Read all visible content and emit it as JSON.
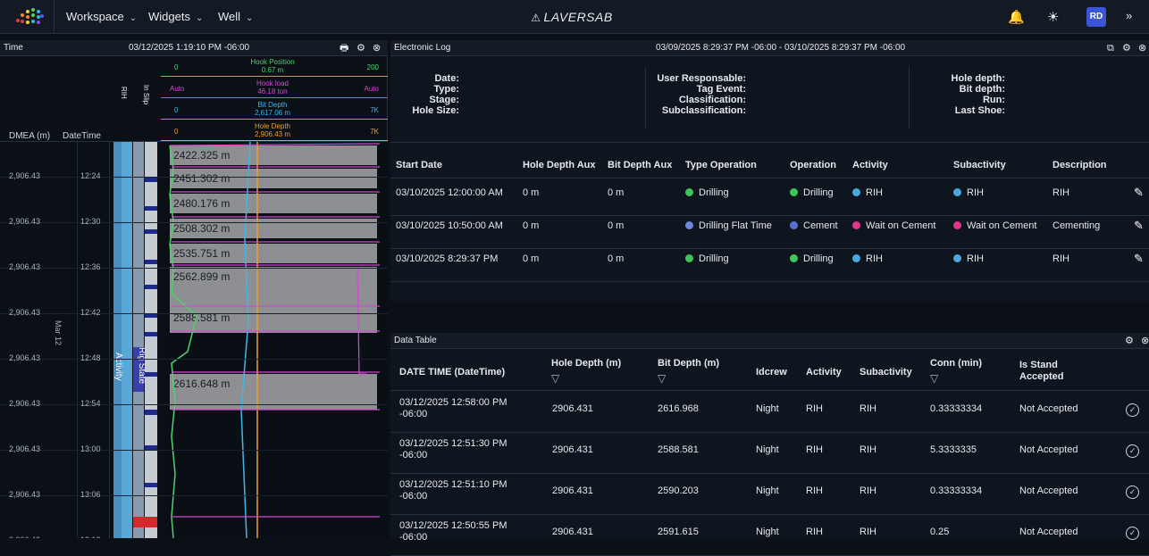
{
  "topbar": {
    "menus": [
      {
        "label": "Workspace"
      },
      {
        "label": "Widgets"
      },
      {
        "label": "Well"
      }
    ],
    "brand": "LAVERSAB",
    "avatar": "RD",
    "colors": {
      "avatar": "#3a55d6",
      "bar": "#131a24"
    }
  },
  "timelog": {
    "title": "Time",
    "timestamp": "03/12/2025 1:19:10 PM -06:00",
    "col_dmea": "DMEA (m)",
    "col_datetime": "DateTime",
    "date_label": "Mar 12",
    "track_rih": "RIH",
    "track_inslip": "In Slip",
    "track_activity": "Activity",
    "track_rigstate": "Rig State",
    "tracks": [
      {
        "name": "Hook Position",
        "value": "0.67 m",
        "min": "0",
        "max": "200",
        "color": "#4cd46a"
      },
      {
        "name": "Hook load",
        "value": "46.18 ton",
        "min": "Auto",
        "max": "Auto",
        "color": "#d14bd1"
      },
      {
        "name": "Bit Depth",
        "value": "2,617.06 m",
        "min": "0",
        "max": "7K",
        "color": "#3fb6e8"
      },
      {
        "name": "Hole Depth",
        "value": "2,906.43 m",
        "min": "0",
        "max": "7K",
        "color": "#f0a02a"
      }
    ],
    "rows": [
      {
        "dmea": "2,906.43",
        "time": "12:24"
      },
      {
        "dmea": "2,906.43",
        "time": "12:30"
      },
      {
        "dmea": "2,906.43",
        "time": "12:36"
      },
      {
        "dmea": "2,906.43",
        "time": "12:42"
      },
      {
        "dmea": "2,906.43",
        "time": "12:48"
      },
      {
        "dmea": "2,906.43",
        "time": "12:54"
      },
      {
        "dmea": "2,906.43",
        "time": "13:00"
      },
      {
        "dmea": "2,906.43",
        "time": "13:06"
      },
      {
        "dmea": "2,906.43",
        "time": "13:12"
      }
    ],
    "depth_markers": [
      "2422.325 m",
      "2451.302 m",
      "2480.176 m",
      "2508.302 m",
      "2535.751 m",
      "2562.899 m",
      "2588.581 m",
      "2616.648 m"
    ]
  },
  "elog": {
    "title": "Electronic Log",
    "range": "03/09/2025 8:29:37 PM -06:00 - 03/10/2025 8:29:37 PM -06:00",
    "fields_left": [
      "Date:",
      "Type:",
      "Stage:",
      "Hole Size:"
    ],
    "fields_mid": [
      "User Responsable:",
      "Tag Event:",
      "Classification:",
      "Subclassification:"
    ],
    "fields_right": [
      "Hole depth:",
      "Bit depth:",
      "Run:",
      "Last Shoe:"
    ],
    "headers": [
      "Start Date",
      "Hole Depth Aux",
      "Bit Depth Aux",
      "Type Operation",
      "Operation",
      "Activity",
      "Subactivity",
      "Description"
    ],
    "rows": [
      {
        "start": "03/10/2025 12:00:00 AM",
        "hole": "0 m",
        "bit": "0 m",
        "type": "Drilling",
        "type_color": "#3ec45a",
        "op": "Drilling",
        "op_color": "#3ec45a",
        "act": "RIH",
        "act_color": "#4aa8e0",
        "sub": "RIH",
        "sub_color": "#4aa8e0",
        "desc": "RIH"
      },
      {
        "start": "03/10/2025 10:50:00 AM",
        "hole": "0 m",
        "bit": "0 m",
        "type": "Drilling Flat Time",
        "type_color": "#6d86e0",
        "op": "Cement",
        "op_color": "#5a6fd0",
        "act": "Wait on Cement",
        "act_color": "#e0368c",
        "sub": "Wait on Cement",
        "sub_color": "#e0368c",
        "desc": "Cementing"
      },
      {
        "start": "03/10/2025 8:29:37 PM",
        "hole": "0 m",
        "bit": "0 m",
        "type": "Drilling",
        "type_color": "#3ec45a",
        "op": "Drilling",
        "op_color": "#3ec45a",
        "act": "RIH",
        "act_color": "#4aa8e0",
        "sub": "RIH",
        "sub_color": "#4aa8e0",
        "desc": "RIH"
      }
    ]
  },
  "datatable": {
    "title": "Data Table",
    "headers": [
      "DATE TIME (DateTime)",
      "Hole Depth (m)",
      "Bit Depth (m)",
      "Idcrew",
      "Activity",
      "Subactivity",
      "Conn (min)",
      "Is Stand Accepted"
    ],
    "rows": [
      {
        "dt": "03/12/2025 12:58:00 PM -06:00",
        "hole": "2906.431",
        "bit": "2616.968",
        "crew": "Night",
        "act": "RIH",
        "sub": "RIH",
        "conn": "0.33333334",
        "acc": "Not Accepted"
      },
      {
        "dt": "03/12/2025 12:51:30 PM -06:00",
        "hole": "2906.431",
        "bit": "2588.581",
        "crew": "Night",
        "act": "RIH",
        "sub": "RIH",
        "conn": "5.3333335",
        "acc": "Not Accepted"
      },
      {
        "dt": "03/12/2025 12:51:10 PM -06:00",
        "hole": "2906.431",
        "bit": "2590.203",
        "crew": "Night",
        "act": "RIH",
        "sub": "RIH",
        "conn": "0.33333334",
        "acc": "Not Accepted"
      },
      {
        "dt": "03/12/2025 12:50:55 PM -06:00",
        "hole": "2906.431",
        "bit": "2591.615",
        "crew": "Night",
        "act": "RIH",
        "sub": "RIH",
        "conn": "0.25",
        "acc": "Not Accepted"
      }
    ]
  }
}
